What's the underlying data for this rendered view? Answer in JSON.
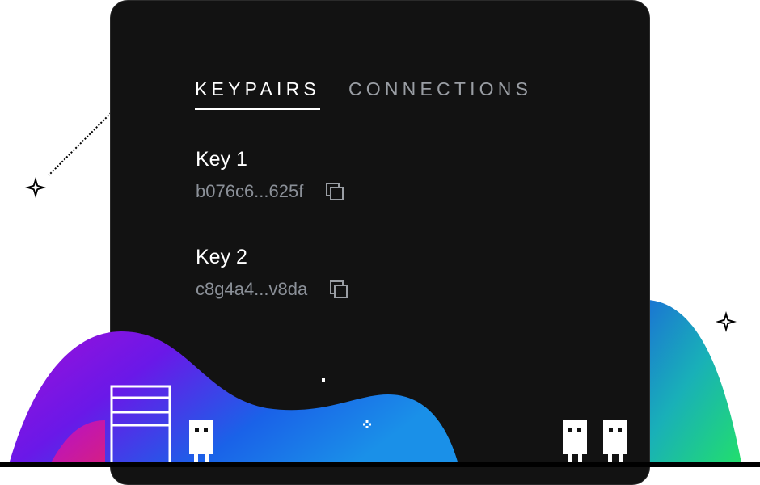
{
  "tabs": [
    {
      "label": "KEYPAIRS",
      "active": true
    },
    {
      "label": "CONNECTIONS",
      "active": false
    }
  ],
  "keypairs": [
    {
      "name": "Key 1",
      "hash": "b076c6...625f"
    },
    {
      "name": "Key 2",
      "hash": "c8g4a4...v8da"
    }
  ],
  "icons": {
    "copy": "copy-icon",
    "sparkle": "sparkle-icon",
    "pixel_character": "pixel-character-icon",
    "pixel_door": "pixel-door-icon"
  },
  "colors": {
    "panel": "#121212",
    "tab_active": "#ffffff",
    "tab_inactive": "#9a9ea4",
    "hash_text": "#8b9098",
    "wave_purple": "#7a12e0",
    "wave_blue": "#1a70e8",
    "wave_green": "#22e06a",
    "wave_pink": "#e0158a"
  }
}
